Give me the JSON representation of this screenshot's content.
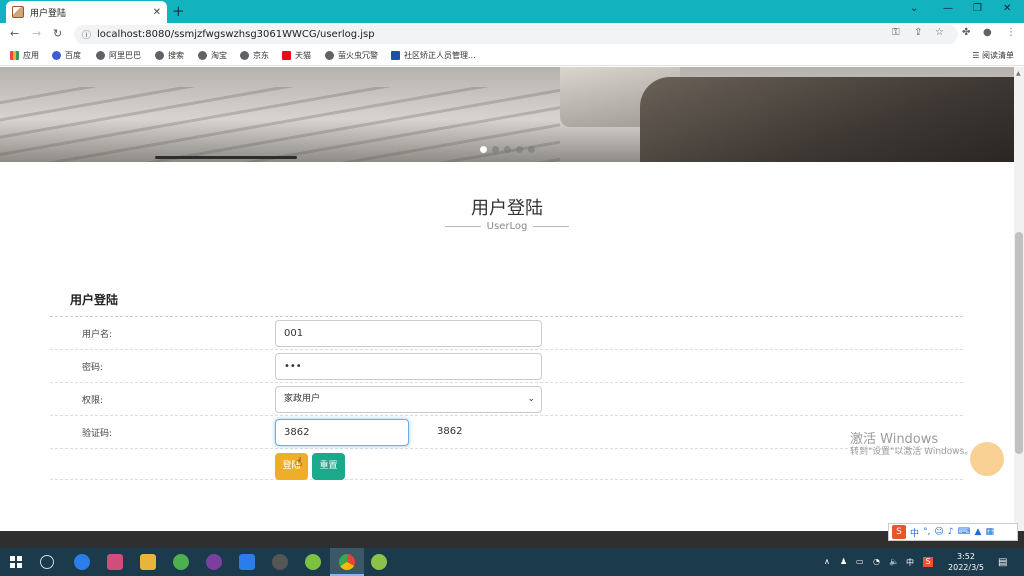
{
  "browser": {
    "tab_title": "用户登陆",
    "url": "localhost:8080/ssmjzfwgswzhsg3061WWCG/userlog.jsp",
    "bookmarks": [
      "应用",
      "百度",
      "阿里巴巴",
      "搜索",
      "淘宝",
      "京东",
      "天猫",
      "萤火虫冗警",
      "社区矫正人员管理..."
    ],
    "reading_list": "阅读清单"
  },
  "section": {
    "title": "用户登陆",
    "subtitle": "UserLog"
  },
  "form": {
    "heading": "用户登陆",
    "fields": {
      "username": {
        "label": "用户名:",
        "value": "001"
      },
      "password": {
        "label": "密码:",
        "value": "•••"
      },
      "role": {
        "label": "权限:",
        "value": "家政用户"
      },
      "captcha": {
        "label": "验证码:",
        "value": "3862",
        "code": "3862"
      }
    },
    "login_label": "登陆",
    "reset_label": "重置"
  },
  "watermark": {
    "line1": "激活 Windows",
    "line2": "转到\"设置\"以激活 Windows。"
  },
  "ime": {
    "mode": "中"
  },
  "taskbar": {
    "time": "3:52",
    "date": "2022/3/5"
  },
  "colors": {
    "tabbar": "#12b3bf",
    "login_button": "#f0ad2a",
    "reset_button": "#1aa98a",
    "taskbar": "#1b3a4b"
  }
}
